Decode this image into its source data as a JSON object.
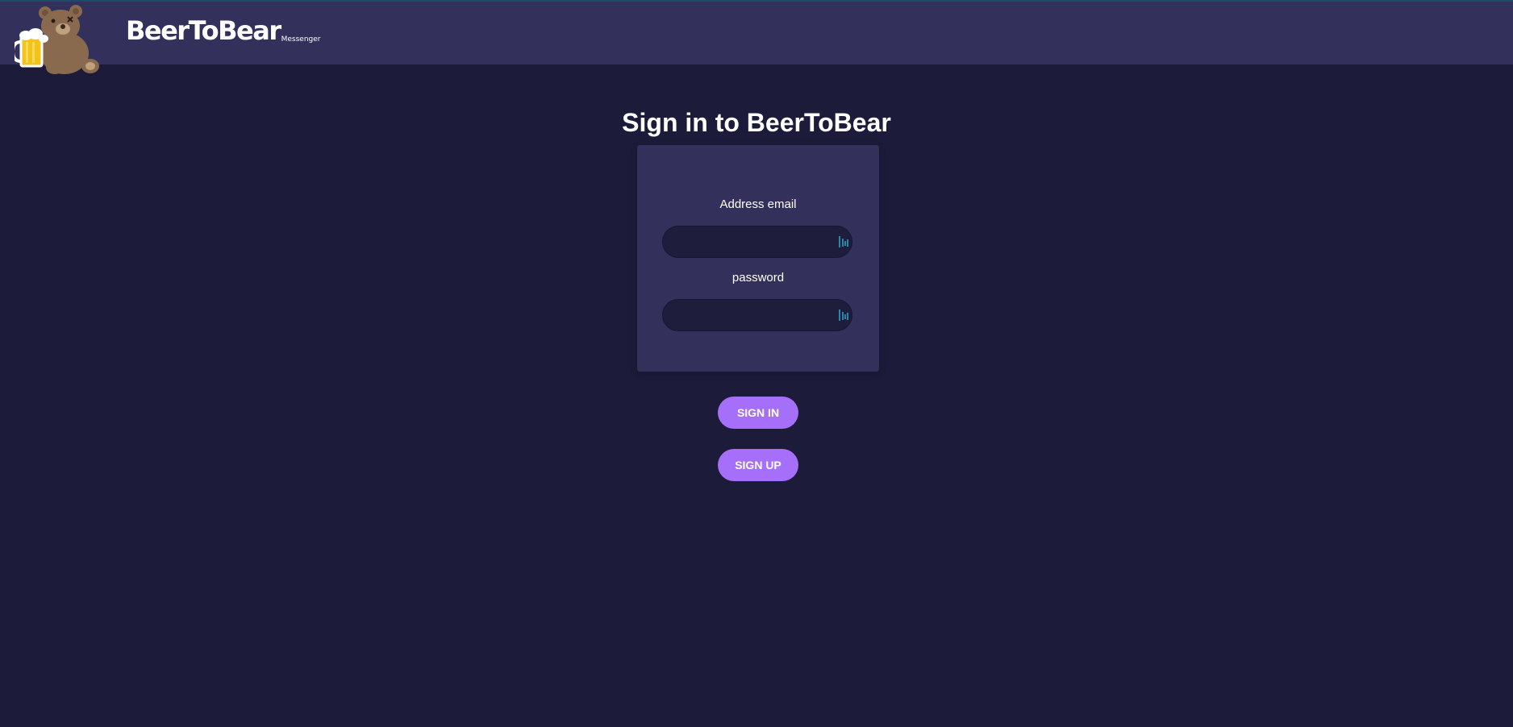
{
  "header": {
    "brand_name": "BeerToBear",
    "brand_sub": "Messenger",
    "logo_icon": "teddy-bear-with-beer-mug-icon"
  },
  "page": {
    "title": "Sign in to BeerToBear"
  },
  "form": {
    "email_label": "Address email",
    "email_value": "",
    "password_label": "password",
    "password_value": "",
    "field_icon": "password-manager-key-icon"
  },
  "actions": {
    "sign_in_label": "SIGN IN",
    "sign_up_label": "SIGN UP"
  },
  "colors": {
    "background": "#1c1b39",
    "header": "#33315b",
    "card": "#33315b",
    "input": "#1e1d3c",
    "button": "#a66ffa",
    "field_icon": "#2a86a8"
  }
}
